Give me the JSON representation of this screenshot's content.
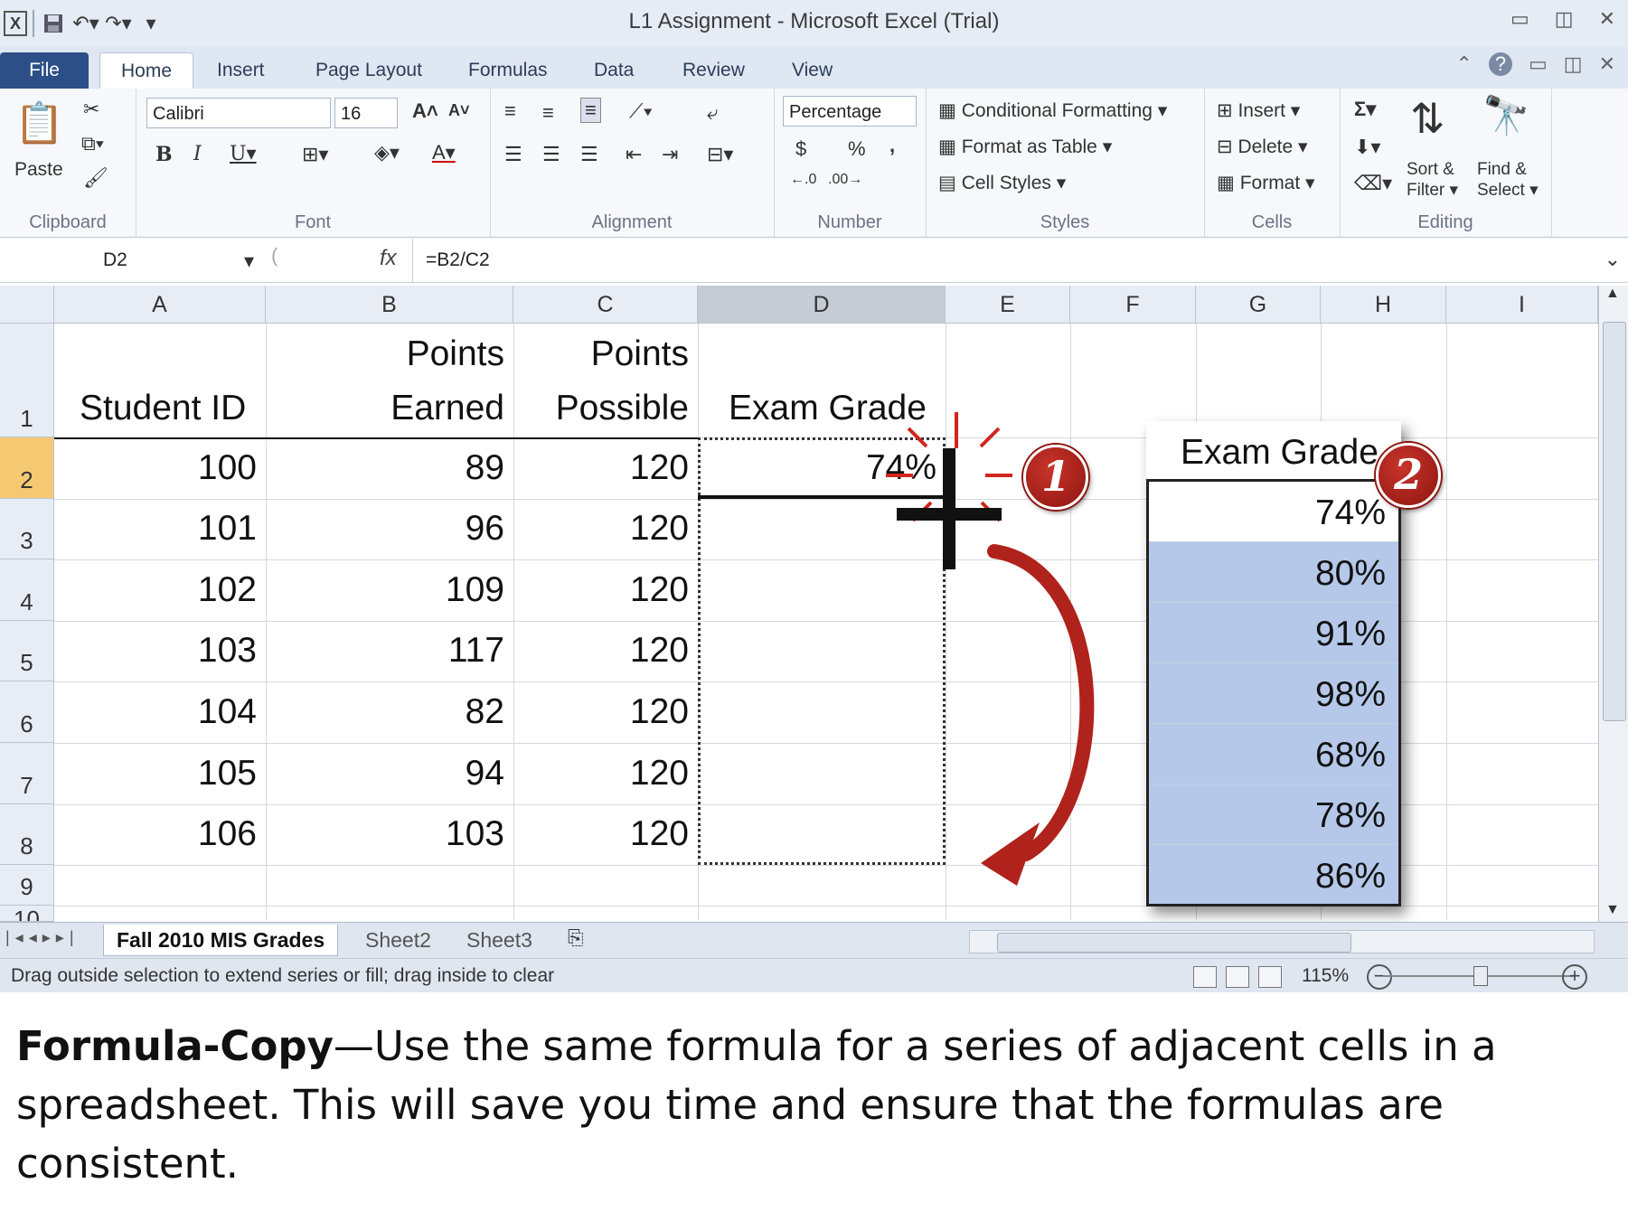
{
  "window": {
    "title": "L1 Assignment  -  Microsoft Excel (Trial)",
    "quick_access": [
      "excel-icon",
      "save-icon",
      "undo-icon",
      "redo-icon",
      "customize-icon"
    ]
  },
  "ribbon": {
    "tabs": [
      "File",
      "Home",
      "Insert",
      "Page Layout",
      "Formulas",
      "Data",
      "Review",
      "View"
    ],
    "active_tab": "Home",
    "clipboard": {
      "paste": "Paste",
      "label": "Clipboard"
    },
    "font": {
      "name": "Calibri",
      "size": "16",
      "label": "Font"
    },
    "alignment": {
      "label": "Alignment"
    },
    "number": {
      "format": "Percentage",
      "currency": "$",
      "percent": "%",
      "comma": ",",
      "label": "Number"
    },
    "styles": {
      "conditional": "Conditional Formatting",
      "format_table": "Format as Table",
      "cell_styles": "Cell Styles",
      "label": "Styles"
    },
    "cells": {
      "insert": "Insert",
      "delete": "Delete",
      "format": "Format",
      "label": "Cells"
    },
    "editing": {
      "sum": "Σ",
      "sort1": "Sort &",
      "sort2": "Filter",
      "find1": "Find &",
      "find2": "Select",
      "label": "Editing"
    }
  },
  "formula_bar": {
    "name_box": "D2",
    "fx": "fx",
    "formula": "=B2/C2"
  },
  "grid": {
    "columns": [
      "A",
      "B",
      "C",
      "D",
      "E",
      "F",
      "G",
      "H",
      "I"
    ],
    "rows": [
      "1",
      "2",
      "3",
      "4",
      "5",
      "6",
      "7",
      "8",
      "9",
      "10"
    ],
    "header": {
      "a": "Student ID",
      "b1": "Points",
      "b2": "Earned",
      "c1": "Points",
      "c2": "Possible",
      "d": "Exam Grade"
    },
    "data": [
      {
        "id": "100",
        "earned": "89",
        "possible": "120",
        "grade": "74%"
      },
      {
        "id": "101",
        "earned": "96",
        "possible": "120",
        "grade": ""
      },
      {
        "id": "102",
        "earned": "109",
        "possible": "120",
        "grade": ""
      },
      {
        "id": "103",
        "earned": "117",
        "possible": "120",
        "grade": ""
      },
      {
        "id": "104",
        "earned": "82",
        "possible": "120",
        "grade": ""
      },
      {
        "id": "105",
        "earned": "94",
        "possible": "120",
        "grade": ""
      },
      {
        "id": "106",
        "earned": "103",
        "possible": "120",
        "grade": ""
      }
    ]
  },
  "inset": {
    "header": "Exam Grade",
    "values": [
      "74%",
      "80%",
      "91%",
      "98%",
      "68%",
      "78%",
      "86%"
    ]
  },
  "badges": [
    "1",
    "2"
  ],
  "sheets": [
    "Fall 2010 MIS Grades",
    "Sheet2",
    "Sheet3"
  ],
  "status": {
    "text": "Drag outside selection to extend series or fill; drag inside to clear",
    "zoom": "115%"
  },
  "caption": {
    "bold": "Formula-Copy",
    "text": "—Use the same formula for a series of adjacent cells in a spreadsheet.  This will save you time and ensure that the formulas are consistent."
  },
  "colors": {
    "selection_blue": "#b5c8e9",
    "badge_red": "#b0231c",
    "file_tab": "#2c4f87"
  }
}
